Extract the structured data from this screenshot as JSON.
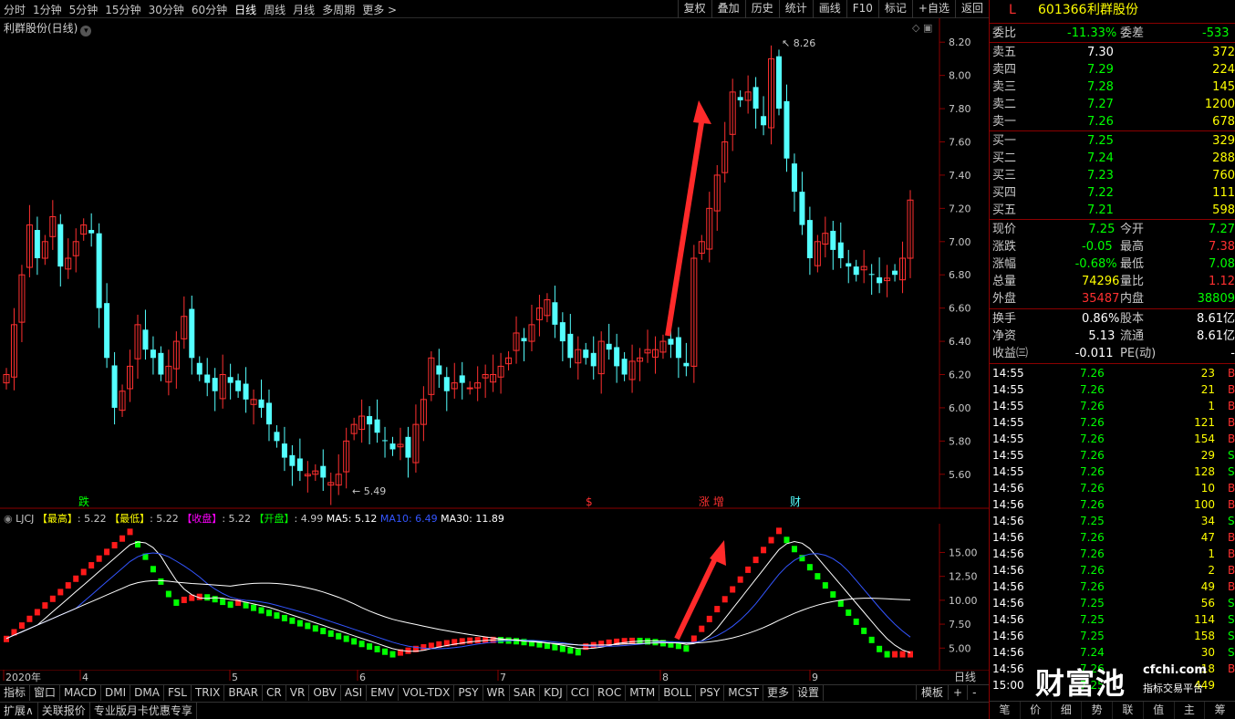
{
  "topbar": {
    "periods": [
      "分时",
      "1分钟",
      "5分钟",
      "15分钟",
      "30分钟",
      "60分钟",
      "日线",
      "周线",
      "月线",
      "多周期",
      "更多 >"
    ],
    "active_period": "日线",
    "tools": [
      "复权",
      "叠加",
      "历史",
      "统计",
      "画线",
      "F10",
      "标记",
      "+自选",
      "返回"
    ]
  },
  "chart_title": "利群股份(日线)",
  "price_axis": [
    "8.20",
    "8.00",
    "7.80",
    "7.60",
    "7.40",
    "7.20",
    "7.00",
    "6.80",
    "6.60",
    "6.40",
    "6.20",
    "6.00",
    "5.80",
    "5.60"
  ],
  "annotations": {
    "high": "8.26",
    "low": "5.49"
  },
  "event_markers": [
    "跌",
    "$",
    "涨 增",
    "财"
  ],
  "indicator": {
    "name": "LJCJ",
    "fields": [
      {
        "label": "【最高】",
        "value": ": 5.22",
        "color": "#ffff00"
      },
      {
        "label": "【最低】",
        "value": ": 5.22",
        "color": "#ffff00"
      },
      {
        "label": "【收盘】",
        "value": ": 5.22",
        "color": "#ff00ff"
      },
      {
        "label": "【开盘】",
        "value": ": 4.99",
        "color": "#00ff00"
      }
    ],
    "ma": [
      {
        "label": "MA5: 5.12",
        "color": "#ffffff"
      },
      {
        "label": "MA10: 6.49",
        "color": "#3355ff"
      },
      {
        "label": "MA30: 11.89",
        "color": "#ffffff"
      }
    ],
    "axis": [
      "15.00",
      "12.50",
      "10.00",
      "7.50",
      "5.00"
    ]
  },
  "date_axis": [
    "2020年",
    "4",
    "5",
    "6",
    "7",
    "8",
    "9"
  ],
  "period_label": "日线",
  "bottom_tabs": [
    "指标",
    "窗口",
    "MACD",
    "DMI",
    "DMA",
    "FSL",
    "TRIX",
    "BRAR",
    "CR",
    "VR",
    "OBV",
    "ASI",
    "EMV",
    "VOL-TDX",
    "PSY",
    "WR",
    "SAR",
    "KDJ",
    "CCI",
    "ROC",
    "MTM",
    "BOLL",
    "PSY",
    "MCST",
    "更多",
    "设置"
  ],
  "bottom_right": [
    "模板",
    "+",
    "-"
  ],
  "status_tabs": [
    "扩展∧",
    "关联报价",
    "专业版月卡优惠专享"
  ],
  "stock": {
    "code": "601366",
    "name": "利群股份",
    "flag": "L"
  },
  "weibi": {
    "label": "委比",
    "value": "-11.33%",
    "label2": "委差",
    "value2": "-533"
  },
  "asks": [
    {
      "label": "卖五",
      "price": "7.30",
      "vol": "372"
    },
    {
      "label": "卖四",
      "price": "7.29",
      "vol": "224"
    },
    {
      "label": "卖三",
      "price": "7.28",
      "vol": "145"
    },
    {
      "label": "卖二",
      "price": "7.27",
      "vol": "1200"
    },
    {
      "label": "卖一",
      "price": "7.26",
      "vol": "678"
    }
  ],
  "bids": [
    {
      "label": "买一",
      "price": "7.25",
      "vol": "329"
    },
    {
      "label": "买二",
      "price": "7.24",
      "vol": "288"
    },
    {
      "label": "买三",
      "price": "7.23",
      "vol": "760"
    },
    {
      "label": "买四",
      "price": "7.22",
      "vol": "111"
    },
    {
      "label": "买五",
      "price": "7.21",
      "vol": "598"
    }
  ],
  "quote": [
    {
      "l1": "现价",
      "v1": "7.25",
      "c1": "#00ff00",
      "l2": "今开",
      "v2": "7.27",
      "c2": "#00ff00"
    },
    {
      "l1": "涨跌",
      "v1": "-0.05",
      "c1": "#00ff00",
      "l2": "最高",
      "v2": "7.38",
      "c2": "#ff3030"
    },
    {
      "l1": "涨幅",
      "v1": "-0.68%",
      "c1": "#00ff00",
      "l2": "最低",
      "v2": "7.08",
      "c2": "#00ff00"
    },
    {
      "l1": "总量",
      "v1": "74296",
      "c1": "#ffff00",
      "l2": "量比",
      "v2": "1.12",
      "c2": "#ff3030"
    },
    {
      "l1": "外盘",
      "v1": "35487",
      "c1": "#ff3030",
      "l2": "内盘",
      "v2": "38809",
      "c2": "#00ff00"
    }
  ],
  "stats": [
    {
      "l1": "换手",
      "v1": "0.86%",
      "l2": "股本",
      "v2": "8.61亿"
    },
    {
      "l1": "净资",
      "v1": "5.13",
      "l2": "流通",
      "v2": "8.61亿"
    },
    {
      "l1": "收益㈢",
      "v1": "-0.011",
      "l2": "PE(动)",
      "v2": "-"
    }
  ],
  "ticks": [
    {
      "t": "14:55",
      "p": "7.26",
      "v": "23",
      "s": "B"
    },
    {
      "t": "14:55",
      "p": "7.26",
      "v": "21",
      "s": "B"
    },
    {
      "t": "14:55",
      "p": "7.26",
      "v": "1",
      "s": "B"
    },
    {
      "t": "14:55",
      "p": "7.26",
      "v": "121",
      "s": "B"
    },
    {
      "t": "14:55",
      "p": "7.26",
      "v": "154",
      "s": "B"
    },
    {
      "t": "14:55",
      "p": "7.26",
      "v": "29",
      "s": "S"
    },
    {
      "t": "14:55",
      "p": "7.26",
      "v": "128",
      "s": "S"
    },
    {
      "t": "14:56",
      "p": "7.26",
      "v": "10",
      "s": "B"
    },
    {
      "t": "14:56",
      "p": "7.26",
      "v": "100",
      "s": "B"
    },
    {
      "t": "14:56",
      "p": "7.25",
      "v": "34",
      "s": "S"
    },
    {
      "t": "14:56",
      "p": "7.26",
      "v": "47",
      "s": "B"
    },
    {
      "t": "14:56",
      "p": "7.26",
      "v": "1",
      "s": "B"
    },
    {
      "t": "14:56",
      "p": "7.26",
      "v": "2",
      "s": "B"
    },
    {
      "t": "14:56",
      "p": "7.26",
      "v": "49",
      "s": "B"
    },
    {
      "t": "14:56",
      "p": "7.25",
      "v": "56",
      "s": "S"
    },
    {
      "t": "14:56",
      "p": "7.25",
      "v": "114",
      "s": "S"
    },
    {
      "t": "14:56",
      "p": "7.25",
      "v": "158",
      "s": "S"
    },
    {
      "t": "14:56",
      "p": "7.24",
      "v": "30",
      "s": "S"
    },
    {
      "t": "14:56",
      "p": "7.26",
      "v": "18",
      "s": "B"
    },
    {
      "t": "15:00",
      "p": "7.25",
      "v": "449",
      "s": ""
    }
  ],
  "bottom_nav": [
    "笔",
    "价",
    "细",
    "势",
    "联",
    "值",
    "主",
    "筹"
  ],
  "watermark": {
    "main": "财富池",
    "url": "cfchi.com",
    "sub": "指标交易平台"
  },
  "colors": {
    "up": "#ff3030",
    "down": "#54ffff",
    "green": "#00ff00",
    "yellow": "#ffff00",
    "border": "#8b0000",
    "arrow": "#ff2a2a"
  }
}
